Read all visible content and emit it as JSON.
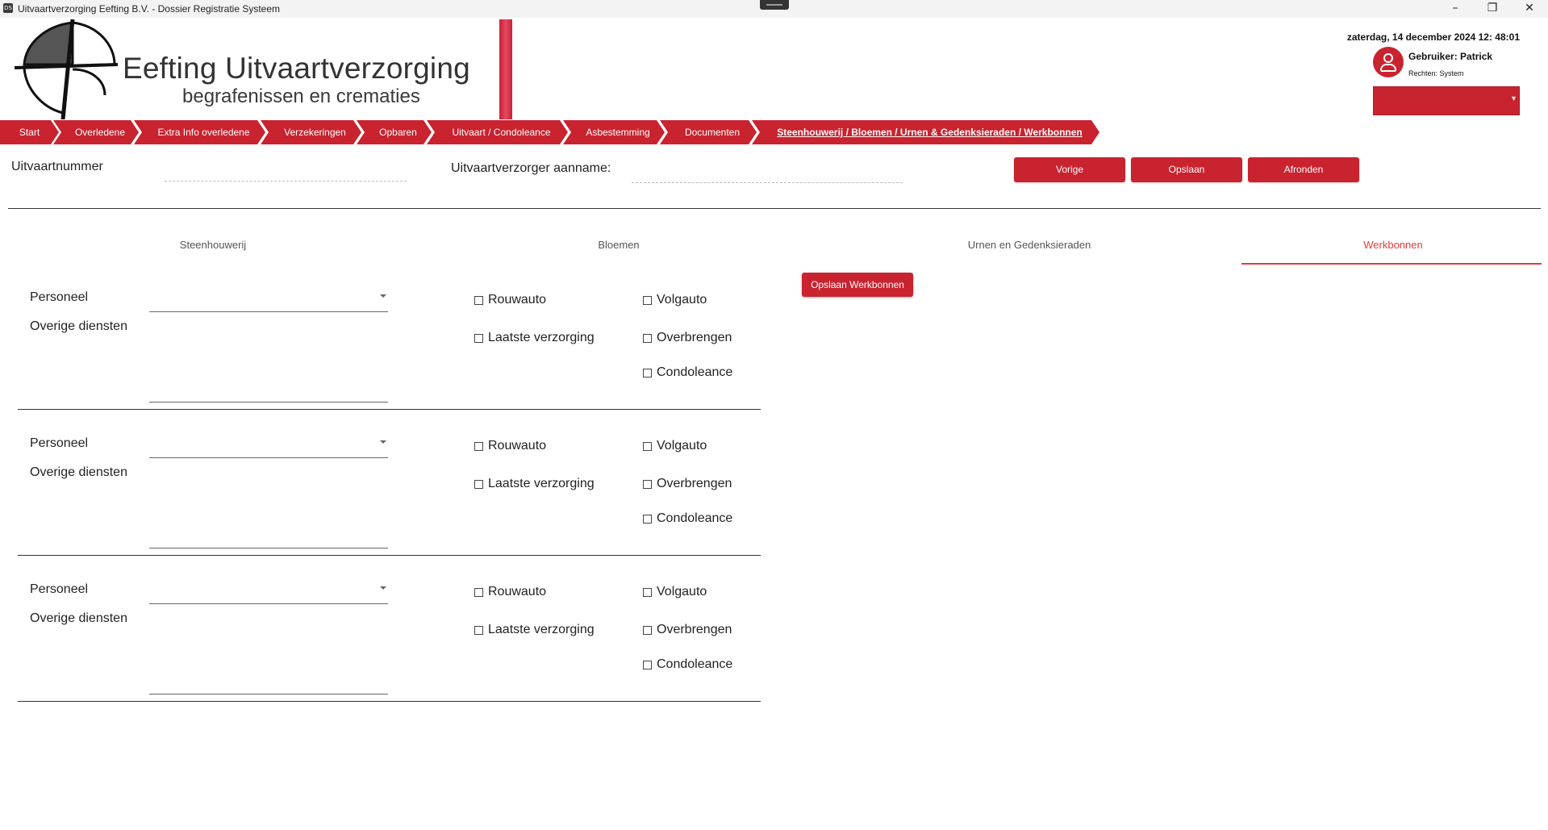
{
  "window": {
    "title": "Uitvaartverzorging Eefting B.V. - Dossier Registratie Systeem",
    "icon_text": "DS",
    "controls": {
      "minimize": "–",
      "restore": "❐",
      "close": "✕"
    }
  },
  "brand": {
    "title": "Eefting Uitvaartverzorging",
    "subtitle": "begrafenissen en crematies"
  },
  "header": {
    "datetime": "zaterdag, 14 december 2024 12: 48:01",
    "user": "Gebruiker: Patrick",
    "rights": "Rechten: System",
    "select_caret": "▾"
  },
  "nav": {
    "items": [
      "Start",
      "Overledene",
      "Extra Info overledene",
      "Verzekeringen",
      "Opbaren",
      "Uitvaart / Condoleance",
      "Asbestemming",
      "Documenten",
      "Steenhouwerij / Bloemen / Urnen & Gedenksieraden / Werkbonnen"
    ]
  },
  "form": {
    "uitvaartnummer_label": "Uitvaartnummer",
    "aanname_label": "Uitvaartverzorger aanname:",
    "buttons": {
      "vorige": "Vorige",
      "opslaan": "Opslaan",
      "afronden": "Afronden"
    }
  },
  "tabs": {
    "items": [
      "Steenhouwerij",
      "Bloemen",
      "Urnen en Gedenksieraden",
      "Werkbonnen"
    ],
    "active": "Werkbonnen"
  },
  "werkbonnen": {
    "save_button": "Opslaan Werkbonnen",
    "rows": [
      {
        "personeel_label": "Personeel",
        "overige_label": "Overige diensten",
        "checkboxes": {
          "rouwauto": "Rouwauto",
          "volgauto": "Volgauto",
          "laatste": "Laatste verzorging",
          "overbrengen": "Overbrengen",
          "condoleance": "Condoleance"
        }
      },
      {
        "personeel_label": "Personeel",
        "overige_label": "Overige diensten",
        "checkboxes": {
          "rouwauto": "Rouwauto",
          "volgauto": "Volgauto",
          "laatste": "Laatste verzorging",
          "overbrengen": "Overbrengen",
          "condoleance": "Condoleance"
        }
      },
      {
        "personeel_label": "Personeel",
        "overige_label": "Overige diensten",
        "checkboxes": {
          "rouwauto": "Rouwauto",
          "volgauto": "Volgauto",
          "laatste": "Laatste verzorging",
          "overbrengen": "Overbrengen",
          "condoleance": "Condoleance"
        }
      }
    ]
  },
  "colors": {
    "accent": "#c8232f",
    "active_tab": "#e23b3b"
  }
}
